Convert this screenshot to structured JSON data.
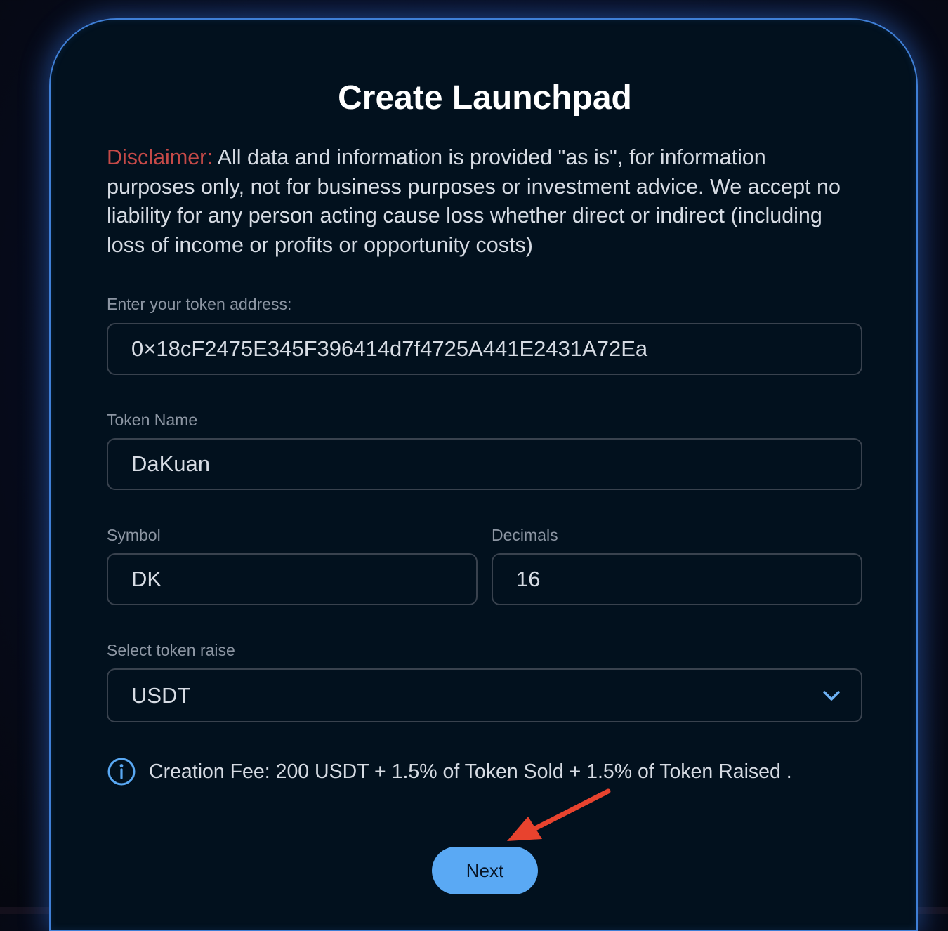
{
  "page": {
    "title": "Create Launchpad"
  },
  "disclaimer": {
    "label": "Disclaimer:",
    "text": " All data and information is provided \"as is\", for information purposes only, not for business purposes or investment advice. We accept no liability for any person acting cause loss whether direct or indirect (including loss of income or profits or opportunity costs)"
  },
  "form": {
    "token_address": {
      "label": "Enter your token address:",
      "value": "0×18cF2475E345F396414d7f4725A441E2431A72Ea"
    },
    "token_name": {
      "label": "Token Name",
      "value": "DaKuan"
    },
    "symbol": {
      "label": "Symbol",
      "value": "DK"
    },
    "decimals": {
      "label": "Decimals",
      "value": "16"
    },
    "token_raise": {
      "label": "Select token raise",
      "selected": "USDT"
    }
  },
  "fee": {
    "icon": "info-icon",
    "text": "Creation Fee: 200 USDT + 1.5% of Token Sold + 1.5% of Token Raised ."
  },
  "actions": {
    "next_label": "Next"
  },
  "colors": {
    "accent": "#5aa9f4",
    "disclaimer_label": "#c64a48",
    "card_border": "#3f7fd6",
    "annotation_arrow": "#e8432e"
  }
}
